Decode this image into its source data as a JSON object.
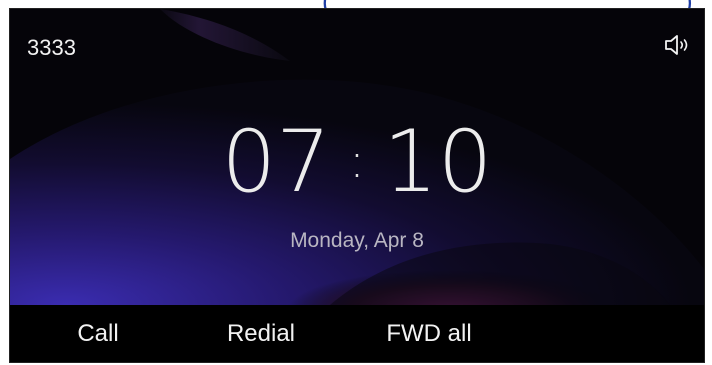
{
  "top_fragment": {
    "open": "(",
    "close": ")"
  },
  "status": {
    "extension": "3333",
    "speaker_icon": "speaker-volume-icon"
  },
  "clock": {
    "hours": "07",
    "separator": ":",
    "minutes": "10"
  },
  "date": "Monday, Apr 8",
  "softkeys": [
    {
      "label": "Call"
    },
    {
      "label": "Redial"
    },
    {
      "label": "FWD all"
    }
  ],
  "colors": {
    "background": "#000000",
    "text": "#f2f2f2",
    "date_text": "#b9b6c2",
    "wallpaper_blue": "#2a1f7a",
    "wallpaper_magenta": "#5a1a52"
  }
}
